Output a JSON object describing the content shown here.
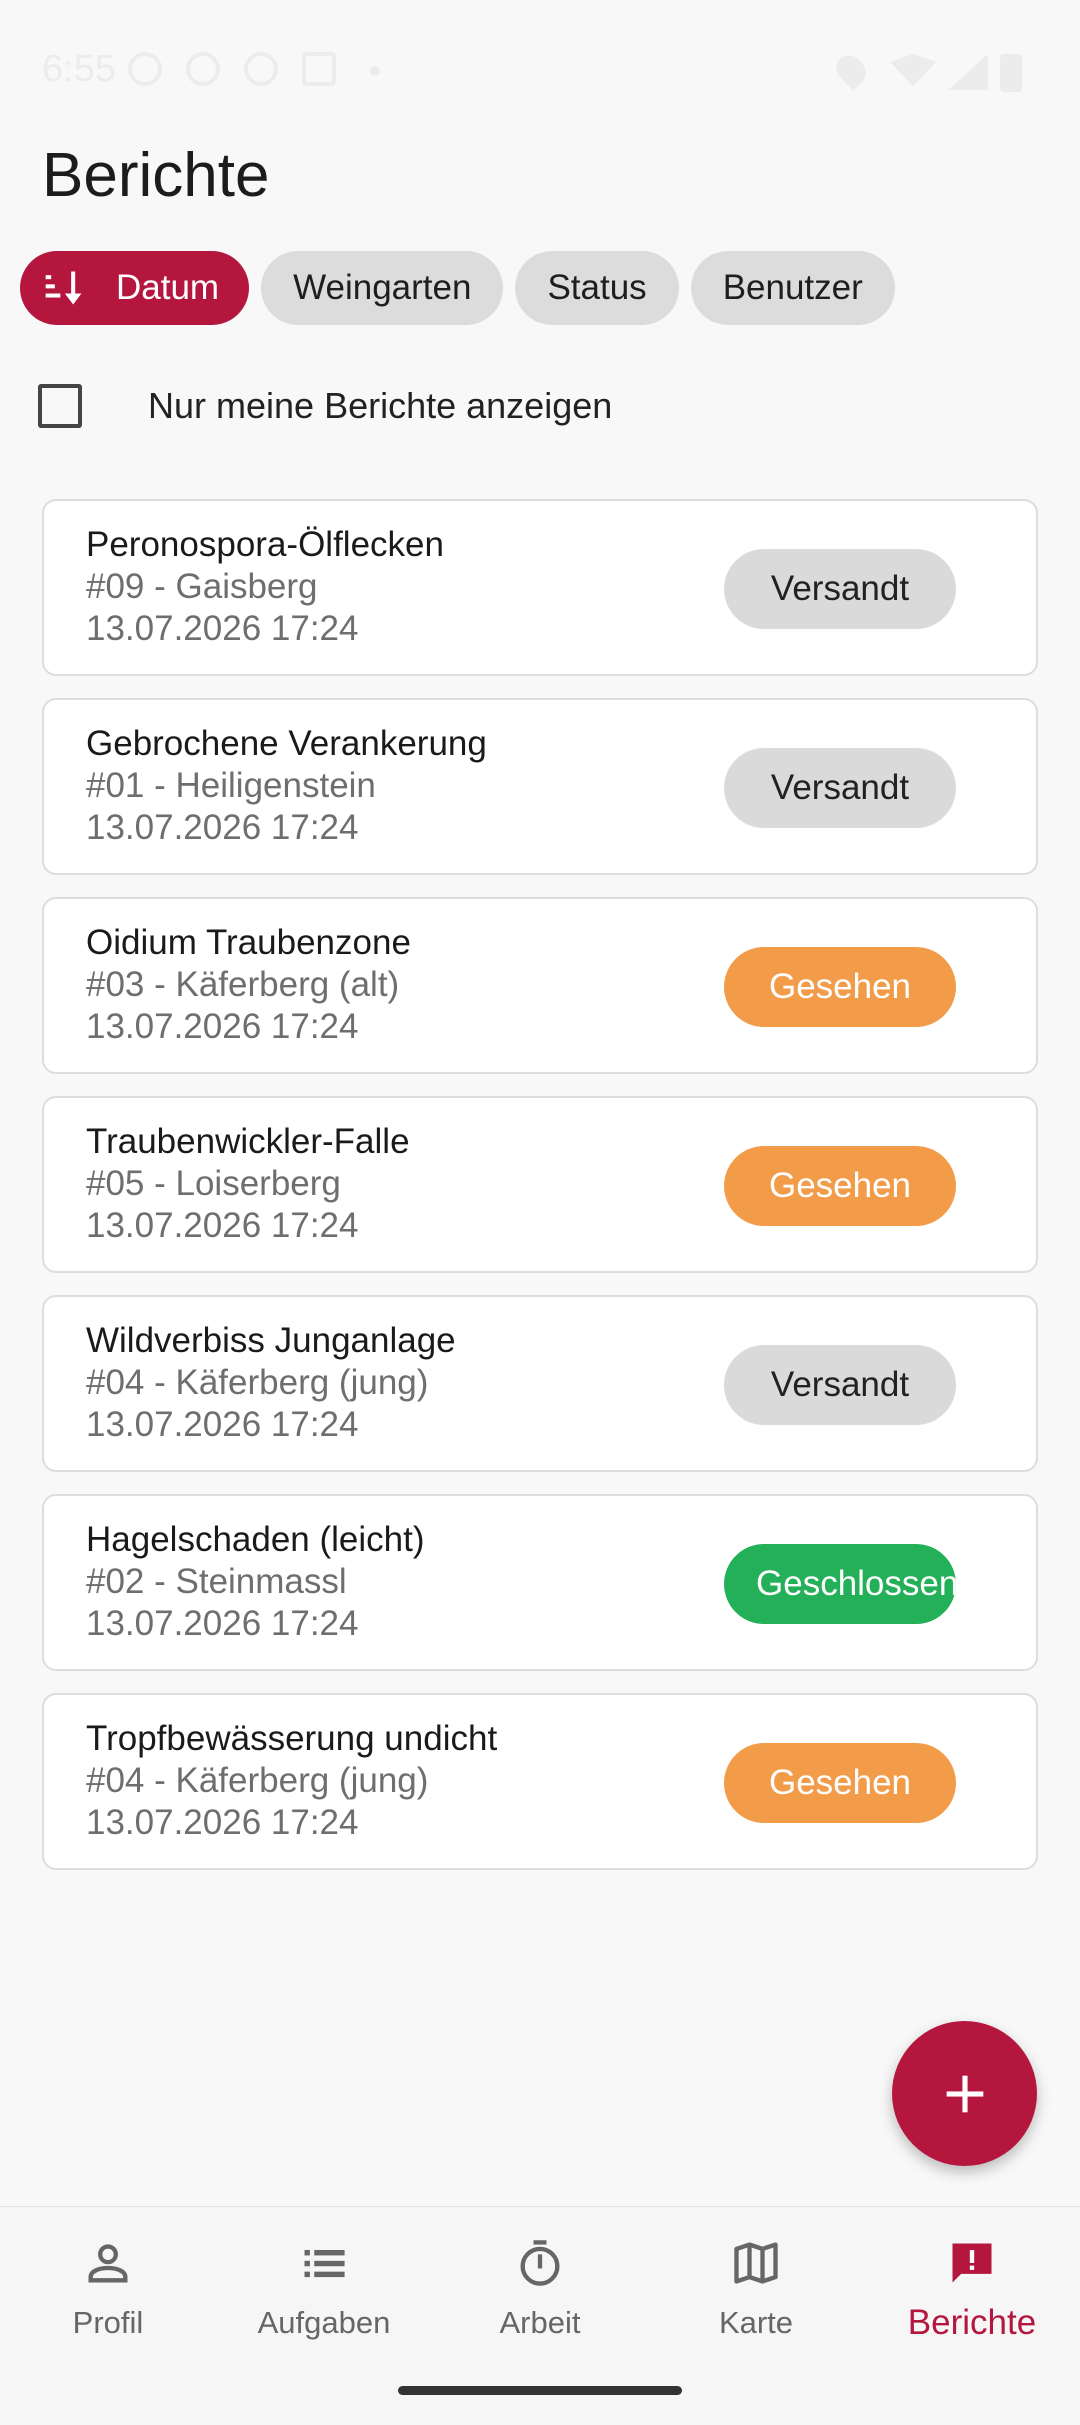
{
  "status_bar": {
    "time": "6:55"
  },
  "page": {
    "title": "Berichte"
  },
  "sort_chips": {
    "active": {
      "label": "Datum",
      "icon": "sort-icon"
    },
    "others": [
      "Weingarten",
      "Status",
      "Benutzer"
    ]
  },
  "filter": {
    "only_mine_label": "Nur meine Berichte anzeigen",
    "only_mine_checked": false
  },
  "reports": [
    {
      "title": "Peronospora-Ölflecken",
      "subtitle": "#09 - Gaisberg",
      "date": "13.07.2026 17:24",
      "status": "Versandt",
      "status_type": "versandt"
    },
    {
      "title": "Gebrochene Verankerung",
      "subtitle": "#01 - Heiligenstein",
      "date": "13.07.2026 17:24",
      "status": "Versandt",
      "status_type": "versandt"
    },
    {
      "title": "Oidium Traubenzone",
      "subtitle": "#03 - Käferberg (alt)",
      "date": "13.07.2026 17:24",
      "status": "Gesehen",
      "status_type": "gesehen"
    },
    {
      "title": "Traubenwickler-Falle",
      "subtitle": "#05 - Loiserberg",
      "date": "13.07.2026 17:24",
      "status": "Gesehen",
      "status_type": "gesehen"
    },
    {
      "title": "Wildverbiss Junganlage",
      "subtitle": "#04 - Käferberg (jung)",
      "date": "13.07.2026 17:24",
      "status": "Versandt",
      "status_type": "versandt"
    },
    {
      "title": "Hagelschaden (leicht)",
      "subtitle": "#02 - Steinmassl",
      "date": "13.07.2026 17:24",
      "status": "Geschlossen",
      "status_type": "geschlossen"
    },
    {
      "title": "Tropfbewässerung undicht",
      "subtitle": "#04 - Käferberg (jung)",
      "date": "13.07.2026 17:24",
      "status": "Gesehen",
      "status_type": "gesehen"
    }
  ],
  "fab": {
    "icon": "plus-icon"
  },
  "bottom_nav": [
    {
      "label": "Profil",
      "icon": "person-icon",
      "active": false
    },
    {
      "label": "Aufgaben",
      "icon": "list-icon",
      "active": false
    },
    {
      "label": "Arbeit",
      "icon": "timer-icon",
      "active": false
    },
    {
      "label": "Karte",
      "icon": "map-icon",
      "active": false
    },
    {
      "label": "Berichte",
      "icon": "report-icon",
      "active": true
    }
  ],
  "colors": {
    "accent": "#B5163E",
    "badge_versandt": "#DADADA",
    "badge_gesehen": "#F29C4A",
    "badge_geschlossen": "#23B058",
    "background": "#F8F8F8"
  }
}
